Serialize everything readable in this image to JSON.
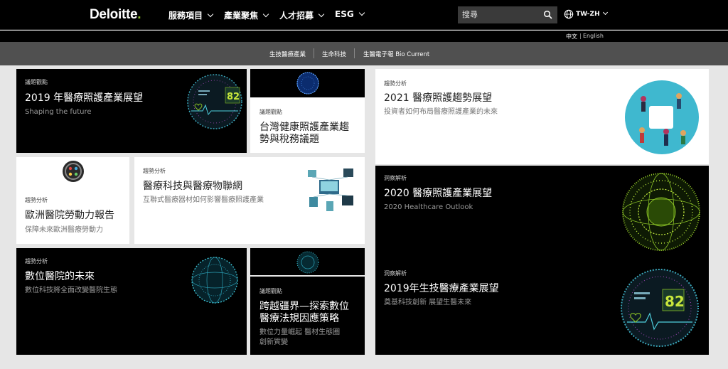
{
  "header": {
    "logo_text": "Deloitte",
    "logo_dot": ".",
    "nav": [
      {
        "label": "服務項目"
      },
      {
        "label": "產業聚焦"
      },
      {
        "label": "人才招募"
      },
      {
        "label": "ESG"
      }
    ],
    "search_placeholder": "搜尋",
    "locale": "TW-ZH",
    "lang_zh": "中文",
    "lang_divider": "|",
    "lang_en": "English"
  },
  "subnav": [
    {
      "label": "生技醫療產業"
    },
    {
      "label": "生命科技"
    },
    {
      "label": "生醫電子報 Bio Current"
    }
  ],
  "cards": [
    {
      "tag": "議題觀點",
      "title": "2019 年醫療照護產業展望",
      "desc": "Shaping the future"
    },
    {
      "tag": "議題觀點",
      "title_lines": [
        "台灣健康照護產業趨",
        "勢與稅務議題"
      ]
    },
    {
      "tag": "趨勢分析",
      "title": "2021 醫療照護趨勢展望",
      "desc": "投資者如何布局醫療照護產業的未來"
    },
    {
      "tag": "趨勢分析",
      "title": "歐洲醫院勞動力報告",
      "desc": "保障未來歐洲醫療勞動力"
    },
    {
      "tag": "趨勢分析",
      "title": "醫療科技與醫療物聯網",
      "desc": "互聯式醫療器材如何影響醫療照護產業"
    },
    {
      "tag": "洞察解析",
      "title": "2020 醫療照護產業展望",
      "desc": "2020 Healthcare Outlook"
    },
    {
      "tag": "趨勢分析",
      "title": "數位醫院的未來",
      "desc": "數位科技將全面改變醫院生態"
    },
    {
      "tag": "議題觀點",
      "title_lines": [
        "跨越疆界—探索數位",
        "醫療法規因應策略"
      ],
      "desc_lines": [
        "數位力量崛起  醫材生態圈",
        "創新質變"
      ]
    },
    {
      "tag": "洞察解析",
      "title": "2019年生技醫療產業展望",
      "desc": "奠基科技創新 展望生醫未來"
    }
  ],
  "image_badges": {
    "score": "82"
  },
  "colors": {
    "accent": "#86bc25",
    "nav_bg": "#000000",
    "subnav_bg": "#505050",
    "page_bg": "#e6e6e6"
  }
}
